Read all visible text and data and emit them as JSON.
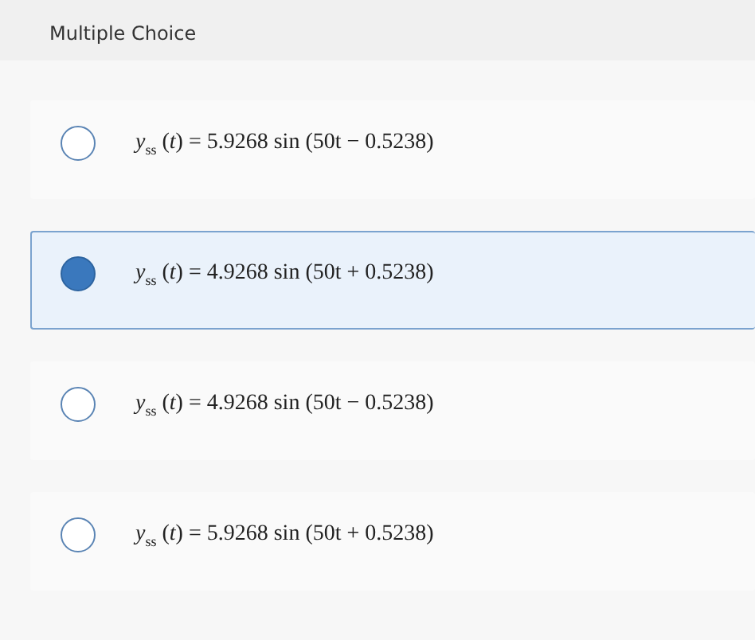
{
  "header": {
    "title": "Multiple Choice"
  },
  "options": [
    {
      "text": "*y*$_{ss}$ (*t*) = 5.9268 sin (50t − 0.5238)",
      "selected": false
    },
    {
      "text": "*y*$_{ss}$ (*t*) = 4.9268 sin (50t + 0.5238)",
      "selected": true
    },
    {
      "text": "*y*$_{ss}$ (*t*) = 4.9268 sin (50t − 0.5238)",
      "selected": false
    },
    {
      "text": "*y*$_{ss}$ (*t*) = 5.9268 sin (50t + 0.5238)",
      "selected": false
    }
  ]
}
